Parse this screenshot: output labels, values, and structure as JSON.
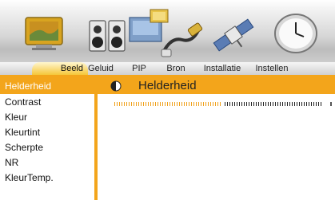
{
  "icons": [
    "tv-picture-icon",
    "speakers-icon",
    "pip-icon",
    "antenna-cable-icon",
    "satellite-icon",
    "clock-settings-icon"
  ],
  "tabs": [
    {
      "label": "Beeld",
      "active": true
    },
    {
      "label": "Geluid",
      "active": false
    },
    {
      "label": "PIP",
      "active": false
    },
    {
      "label": "Bron",
      "active": false
    },
    {
      "label": "Installatie",
      "active": false
    },
    {
      "label": "Instellen",
      "active": false
    }
  ],
  "menu": {
    "items": [
      "Helderheid",
      "Contrast",
      "Kleur",
      "Kleurtint",
      "Scherpte",
      "NR",
      "KleurTemp."
    ],
    "selected_index": 0
  },
  "header": {
    "title": "Helderheid",
    "icon": "brightness-icon"
  },
  "slider": {
    "label": "Helderheid",
    "fraction": 0.52
  },
  "colors": {
    "accent": "#f3a51b",
    "tab_active": "#f5c63a",
    "text": "#111111",
    "selected_text": "#ffffff"
  }
}
